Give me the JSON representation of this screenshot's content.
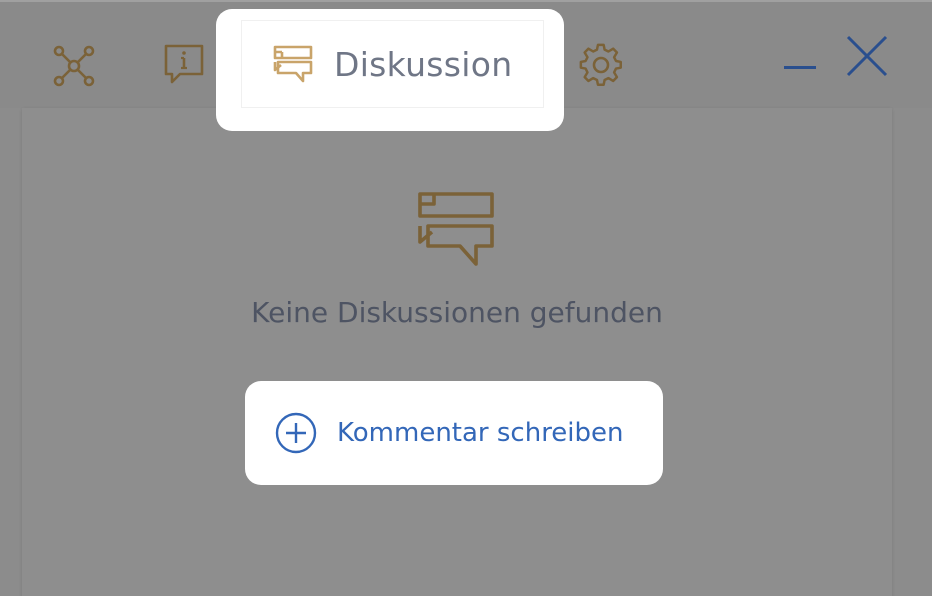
{
  "tabs": {
    "network_icon": "network-icon",
    "info_icon": "info-icon",
    "discussion_label": "Diskussion",
    "discussion_icon": "discussion-icon",
    "settings_icon": "gear-icon"
  },
  "window_controls": {
    "minimize_icon": "minimize-icon",
    "close_icon": "close-icon"
  },
  "main": {
    "empty_state_icon": "discussion-icon",
    "empty_state_text": "Keine Diskussionen gefunden",
    "add_comment_label": "Kommentar schreiben",
    "add_comment_icon": "plus-circle-icon"
  },
  "colors": {
    "icon_gold": "#7b6238",
    "active_icon_gold": "#c9a46a",
    "accent_blue": "#3367b8",
    "close_blue": "#2a4f8e",
    "muted_text": "#6f7686",
    "dark_text": "#4e5463"
  }
}
